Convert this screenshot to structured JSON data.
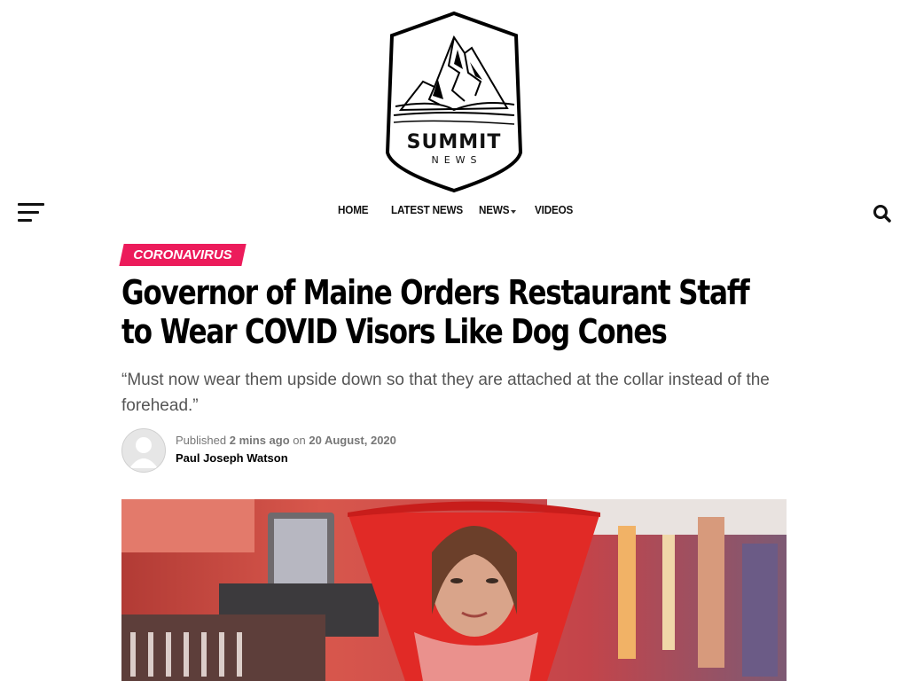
{
  "brand": {
    "name_line1": "SUMMIT",
    "name_line2": "NEWS"
  },
  "nav": {
    "items": [
      {
        "label": "HOME"
      },
      {
        "label": "LATEST NEWS"
      },
      {
        "label": "NEWS",
        "has_dropdown": true
      },
      {
        "label": "VIDEOS"
      }
    ]
  },
  "icons": {
    "menu": "hamburger-icon",
    "search": "search-icon",
    "dropdown": "caret-down-icon"
  },
  "article": {
    "category": "CORONAVIRUS",
    "category_color": "#ec1b5b",
    "title": "Governor of Maine Orders Restaurant Staff to Wear COVID Visors Like Dog Cones",
    "subtitle": "“Must now wear them upside down so that they are attached at the collar instead of the forehead.”",
    "published_label": "Published",
    "published_relative": "2 mins ago",
    "on_label": "on",
    "published_date": "20 August, 2020",
    "author": "Paul Joseph Watson"
  }
}
